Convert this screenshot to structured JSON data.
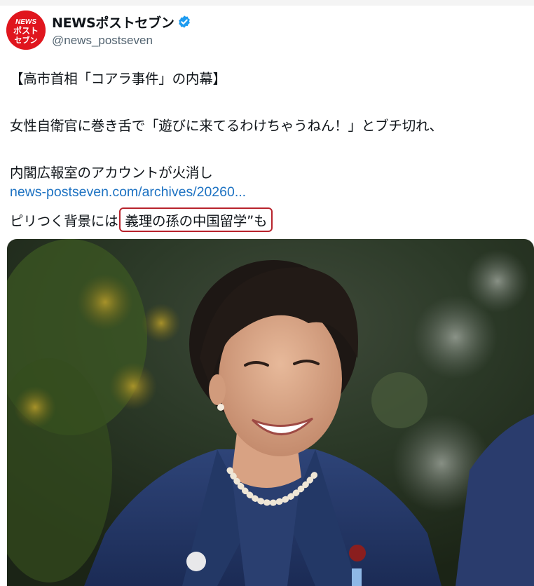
{
  "account": {
    "display_name": "NEWSポストセブン",
    "handle": "@news_postseven",
    "avatar_text": "NEWSポストセブン",
    "verified": true
  },
  "tweet": {
    "line1": "【高市首相「コアラ事件」の内幕】",
    "line2": "女性自衛官に巻き舌で「遊びに来てるわけちゃうねん！」とブチ切れ、",
    "line3": "内閣広報室のアカウントが火消し",
    "link": "news-postseven.com/archives/20260...",
    "line5_prefix": "ピリつく背景には",
    "line5_highlight": "義理の孫の中国留学”も"
  },
  "media": {
    "icon": "photo-of-woman-icon",
    "description_hidden": ""
  },
  "colors": {
    "brand_red": "#e0161e",
    "verified_blue": "#1d9bf0",
    "link_blue": "#1d72c2",
    "highlight_border": "#b8232c"
  }
}
